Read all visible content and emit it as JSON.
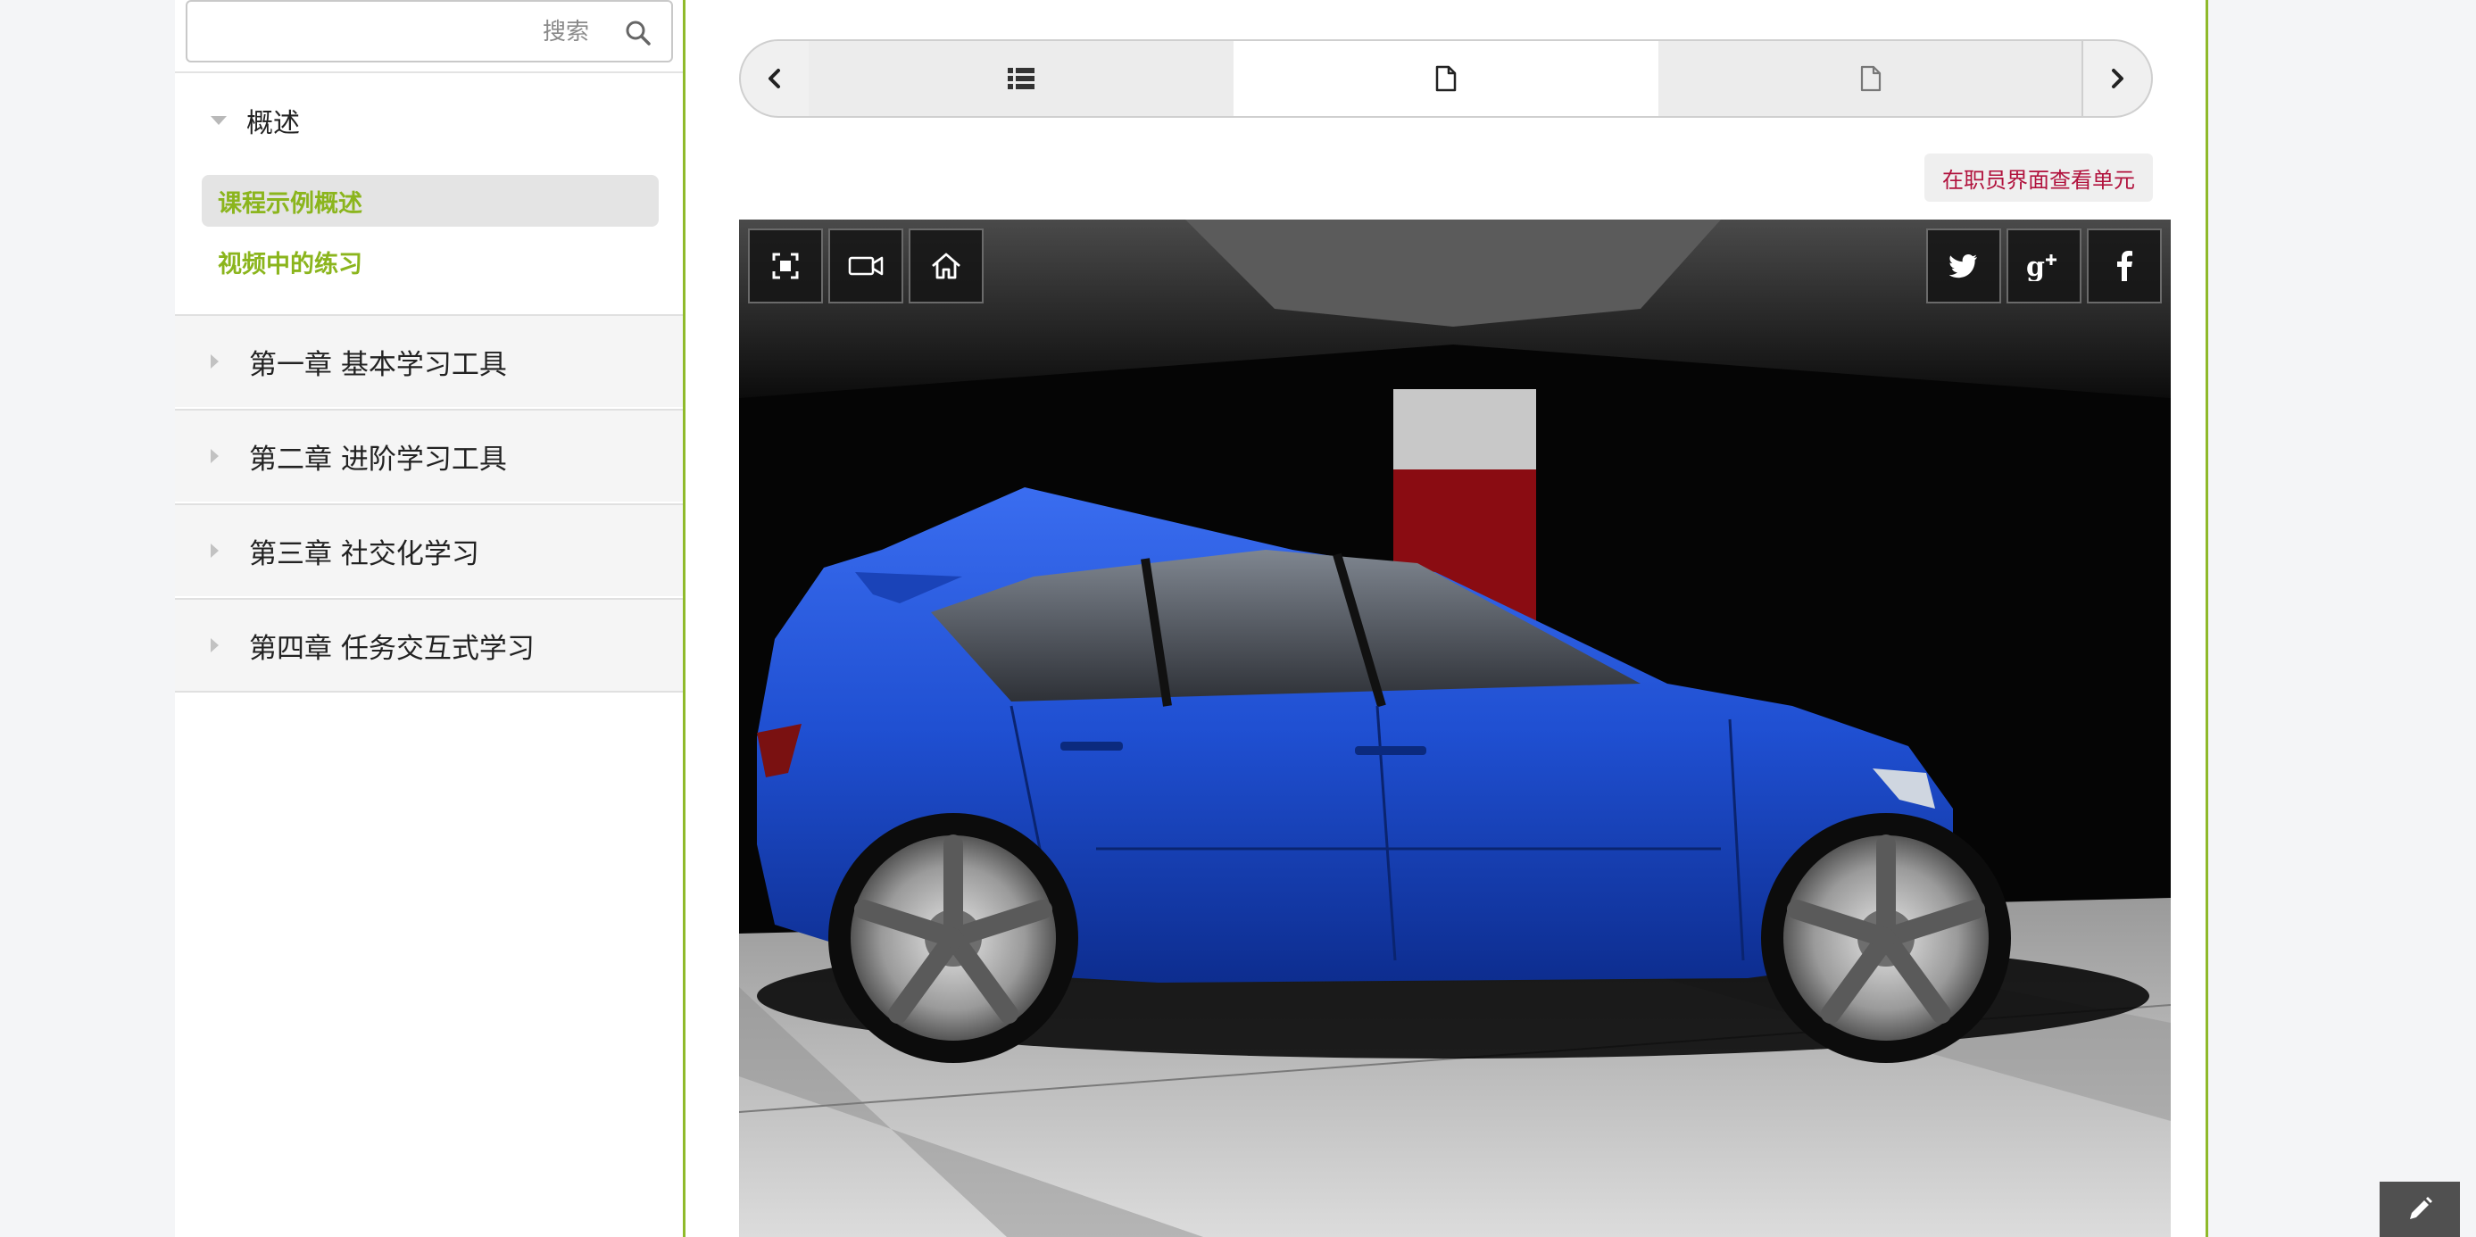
{
  "search": {
    "placeholder": "搜索",
    "icon": "search-icon"
  },
  "sidebar": {
    "section_title": "概述",
    "sub_items": [
      {
        "label": "课程示例概述",
        "active": true
      },
      {
        "label": "视频中的练习",
        "active": false
      }
    ],
    "chapters": [
      {
        "label": "第一章 基本学习工具"
      },
      {
        "label": "第二章 进阶学习工具"
      },
      {
        "label": "第三章 社交化学习"
      },
      {
        "label": "第四章 任务交互式学习"
      }
    ]
  },
  "unit_nav": {
    "prev_icon": "chevron-left-icon",
    "next_icon": "chevron-right-icon",
    "tabs": [
      {
        "icon": "list-icon",
        "active": false
      },
      {
        "icon": "document-icon",
        "active": true
      },
      {
        "icon": "document-icon",
        "active": false
      }
    ]
  },
  "staff_view_label": "在职员界面查看单元",
  "viewer": {
    "left_controls": [
      "fullscreen-icon",
      "camera-icon",
      "home-icon"
    ],
    "share_controls": [
      "twitter-icon",
      "google-plus-icon",
      "facebook-icon"
    ]
  },
  "colors": {
    "accent_green": "#8bb51d",
    "border_green": "#8fba2b",
    "staff_red": "#b1123d",
    "car_blue": "#1f4fd1"
  }
}
